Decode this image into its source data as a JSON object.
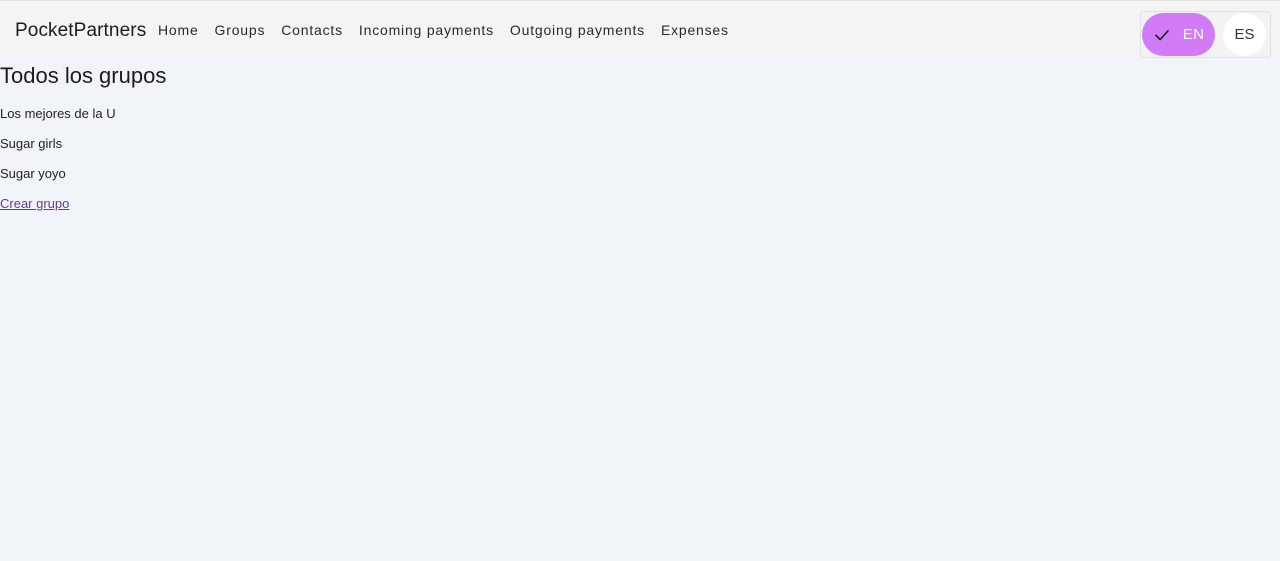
{
  "header": {
    "brand": "PocketPartners",
    "nav": [
      {
        "label": "Home"
      },
      {
        "label": "Groups"
      },
      {
        "label": "Contacts"
      },
      {
        "label": "Incoming payments"
      },
      {
        "label": "Outgoing payments"
      },
      {
        "label": "Expenses"
      }
    ],
    "language_toggle": {
      "options": [
        {
          "label": "EN",
          "selected": true,
          "icon": "check-icon"
        },
        {
          "label": "ES",
          "selected": false
        }
      ],
      "accent_color": "#d17cf6"
    }
  },
  "main": {
    "title": "Todos los grupos",
    "groups": [
      {
        "name": "Los mejores de la U"
      },
      {
        "name": "Sugar girls"
      },
      {
        "name": "Sugar yoyo"
      }
    ],
    "create_link": "Crear grupo"
  }
}
